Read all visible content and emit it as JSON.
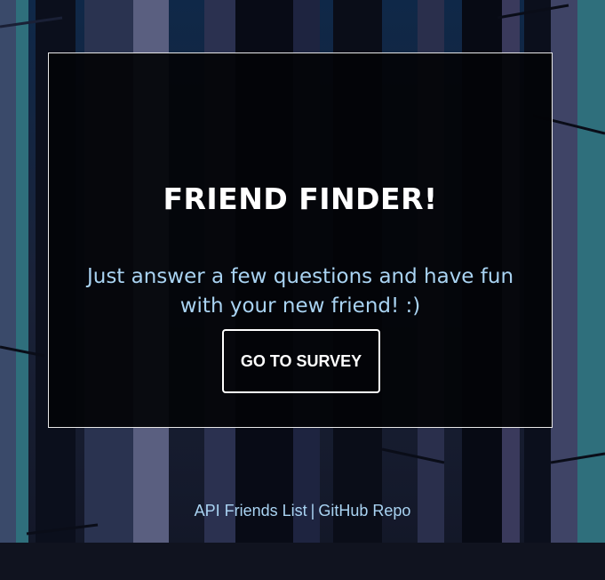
{
  "card": {
    "title": "FRIEND FINDER!",
    "subtitle": "Just answer a few questions and have fun with your new friend! :)",
    "button_label": "GO TO SURVEY"
  },
  "footer": {
    "link_api": "API Friends List",
    "separator": "|",
    "link_repo": "GitHub Repo"
  },
  "colors": {
    "background": "#141a2c",
    "card_background": "#030408",
    "title": "#ffffff",
    "accent_text": "#a9d3f2",
    "teal_tree": "#2f6f7c"
  }
}
